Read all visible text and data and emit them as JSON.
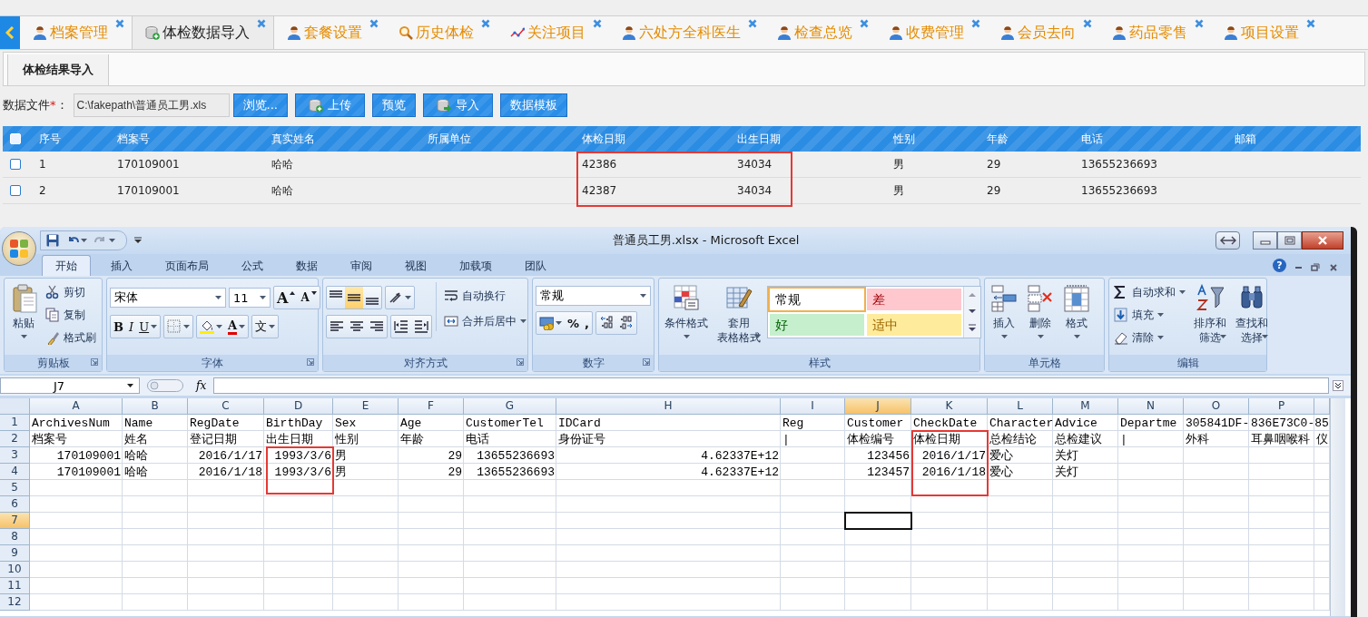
{
  "tabs": [
    {
      "label": "档案管理",
      "kind": "user",
      "selected": false
    },
    {
      "label": "体检数据导入",
      "kind": "database",
      "selected": true
    },
    {
      "label": "套餐设置",
      "kind": "user",
      "selected": false
    },
    {
      "label": "历史体检",
      "kind": "search",
      "selected": false
    },
    {
      "label": "关注项目",
      "kind": "chart",
      "selected": false
    },
    {
      "label": "六处方全科医生",
      "kind": "user",
      "selected": false
    },
    {
      "label": "检查总览",
      "kind": "user",
      "selected": false
    },
    {
      "label": "收费管理",
      "kind": "user",
      "selected": false
    },
    {
      "label": "会员去向",
      "kind": "user",
      "selected": false
    },
    {
      "label": "药品零售",
      "kind": "user",
      "selected": false
    },
    {
      "label": "项目设置",
      "kind": "user",
      "selected": false
    }
  ],
  "subtabs": [
    {
      "label": "体检结果导入",
      "selected": true
    }
  ],
  "import_form": {
    "label": "数据文件",
    "required_mark": "*",
    "colon": "：",
    "file": {
      "value": "C:\\fakepath\\普通员工男.xls"
    },
    "buttons": [
      {
        "label": "浏览...",
        "kind": "plain"
      },
      {
        "label": "上传",
        "kind": "upload"
      },
      {
        "label": "预览",
        "kind": "plain"
      },
      {
        "label": "导入",
        "kind": "import"
      },
      {
        "label": "数据模板",
        "kind": "plain"
      }
    ]
  },
  "table": {
    "all_checked": false,
    "columns": [
      "序号",
      "档案号",
      "真实姓名",
      "所属单位",
      "体检日期",
      "出生日期",
      "性别",
      "年龄",
      "电话",
      "邮箱"
    ],
    "rows": [
      {
        "checked": false,
        "cells": [
          "1",
          "170109001",
          "哈哈",
          null,
          "42386",
          "34034",
          "男",
          "29",
          "13655236693",
          null
        ]
      },
      {
        "checked": false,
        "cells": [
          "2",
          "170109001",
          "哈哈",
          null,
          "42387",
          "34034",
          "男",
          "29",
          "13655236693",
          null
        ]
      }
    ]
  },
  "excel": {
    "title": "普通员工男.xlsx - Microsoft Excel",
    "ribbon_tabs": [
      {
        "label": "开始",
        "selected": true
      },
      {
        "label": "插入",
        "selected": false
      },
      {
        "label": "页面布局",
        "selected": false
      },
      {
        "label": "公式",
        "selected": false
      },
      {
        "label": "数据",
        "selected": false
      },
      {
        "label": "审阅",
        "selected": false
      },
      {
        "label": "视图",
        "selected": false
      },
      {
        "label": "加载项",
        "selected": false
      },
      {
        "label": "团队",
        "selected": false
      }
    ],
    "help": "?",
    "groups": [
      {
        "kind": "clipboard",
        "name": "剪贴板",
        "paste": "粘贴",
        "items": [
          "剪切",
          "复制",
          "格式刷"
        ]
      },
      {
        "kind": "font",
        "name": "字体",
        "font": "宋体",
        "size": "11",
        "grow": "A",
        "shrink": "A",
        "bold": "B",
        "italic": "I",
        "underline": "U",
        "font_color": "A",
        "phonetic": "文"
      },
      {
        "kind": "alignment",
        "name": "对齐方式",
        "vertical": [
          {
            "selected": false
          },
          {
            "selected": true
          },
          {
            "selected": false
          }
        ],
        "wrap": "自动换行",
        "merge": "合并后居中"
      },
      {
        "kind": "number",
        "name": "数字",
        "format": "常规",
        "percent": "%",
        "comma": ","
      },
      {
        "kind": "styles",
        "name": "样式",
        "commands": [
          [
            "条件格式"
          ],
          [
            "套用",
            "表格格式"
          ]
        ],
        "cell_styles": [
          {
            "label": "常规",
            "kind": "normal",
            "selected": true
          },
          {
            "label": "差",
            "kind": "bad",
            "selected": false
          },
          {
            "label": "好",
            "kind": "good",
            "selected": false
          },
          {
            "label": "适中",
            "kind": "neutral",
            "selected": false
          }
        ]
      },
      {
        "kind": "cells",
        "name": "单元格",
        "commands": [
          "插入",
          "删除",
          "格式"
        ]
      },
      {
        "kind": "editing",
        "name": "编辑",
        "items": [
          "自动求和",
          "填充",
          "清除"
        ],
        "commands": [
          [
            "排序和",
            "筛选"
          ],
          [
            "查找和",
            "选择"
          ]
        ]
      }
    ],
    "name_box": "J7",
    "function_label": "fx",
    "sheet": {
      "columns": [
        {
          "label": "A",
          "selected": false
        },
        {
          "label": "B",
          "selected": false
        },
        {
          "label": "C",
          "selected": false
        },
        {
          "label": "D",
          "selected": false
        },
        {
          "label": "E",
          "selected": false
        },
        {
          "label": "F",
          "selected": false
        },
        {
          "label": "G",
          "selected": false
        },
        {
          "label": "H",
          "selected": false
        },
        {
          "label": "I",
          "selected": false
        },
        {
          "label": "J",
          "selected": true
        },
        {
          "label": "K",
          "selected": false
        },
        {
          "label": "L",
          "selected": false
        },
        {
          "label": "M",
          "selected": false
        },
        {
          "label": "N",
          "selected": false
        },
        {
          "label": "O",
          "selected": false
        },
        {
          "label": "P",
          "selected": false
        }
      ],
      "rows": [
        {
          "label": "1",
          "selected": false,
          "cells": [
            "ArchivesNum",
            "Name",
            "RegDate",
            "BirthDay",
            "Sex",
            "Age",
            "CustomerTel",
            "IDCard",
            "Reg",
            "Customer",
            "CheckDate",
            "Character",
            "Advice",
            "Departme",
            "305841DF-",
            "836E73C0-85"
          ]
        },
        {
          "label": "2",
          "selected": false,
          "cells": [
            "档案号",
            "姓名",
            "登记日期",
            "出生日期",
            "性别",
            "年龄",
            "电话",
            "身份证号",
            "|",
            "体检编号",
            "体检日期",
            "总检结论",
            "总检建议",
            "|",
            "外科",
            "耳鼻咽喉科",
            "仪"
          ]
        },
        {
          "label": "3",
          "selected": false,
          "cells": [
            {
              "kind": "number",
              "text": "170109001"
            },
            "哈哈",
            {
              "kind": "number",
              "text": "2016/1/17"
            },
            {
              "kind": "number",
              "text": "1993/3/6"
            },
            "男",
            {
              "kind": "number",
              "text": "29"
            },
            {
              "kind": "number",
              "text": "13655236693"
            },
            {
              "kind": "number",
              "text": "4.62337E+12"
            },
            null,
            {
              "kind": "number",
              "text": "123456"
            },
            {
              "kind": "number",
              "text": "2016/1/17"
            },
            "爱心",
            "关灯"
          ]
        },
        {
          "label": "4",
          "selected": false,
          "cells": [
            {
              "kind": "number",
              "text": "170109001"
            },
            "哈哈",
            {
              "kind": "number",
              "text": "2016/1/18"
            },
            {
              "kind": "number",
              "text": "1993/3/6"
            },
            "男",
            {
              "kind": "number",
              "text": "29"
            },
            {
              "kind": "number",
              "text": "13655236693"
            },
            {
              "kind": "number",
              "text": "4.62337E+12"
            },
            null,
            {
              "kind": "number",
              "text": "123457"
            },
            {
              "kind": "number",
              "text": "2016/1/18"
            },
            "爱心",
            "关灯"
          ]
        },
        {
          "label": "5",
          "selected": false
        },
        {
          "label": "6",
          "selected": false
        },
        {
          "label": "7",
          "selected": true
        },
        {
          "label": "8",
          "selected": false
        },
        {
          "label": "9",
          "selected": false
        },
        {
          "label": "10",
          "selected": false
        },
        {
          "label": "11",
          "selected": false
        },
        {
          "label": "12",
          "selected": false
        }
      ]
    }
  }
}
